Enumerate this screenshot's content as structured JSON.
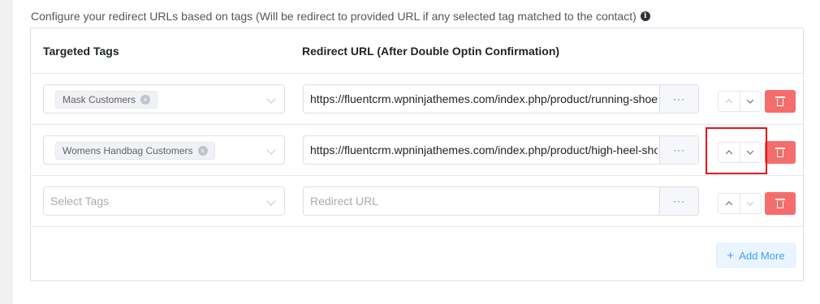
{
  "heading": "Configure your redirect URLs based on tags (Will be redirect to provided URL if any selected tag matched to the contact)",
  "info_icon_glyph": "i",
  "table": {
    "col_tags": "Targeted Tags",
    "col_url": "Redirect URL (After Double Optin Confirmation)"
  },
  "rows": [
    {
      "tag": "Mask Customers",
      "url": "https://fluentcrm.wpninjathemes.com/index.php/product/running-shoe/"
    },
    {
      "tag": "Womens Handbag Customers",
      "url": "https://fluentcrm.wpninjathemes.com/index.php/product/high-heel-shoe/"
    },
    {
      "tag_placeholder": "Select Tags",
      "url_placeholder": "Redirect URL"
    }
  ],
  "url_button_label": "···",
  "tag_remove_glyph": "×",
  "add_more": {
    "plus": "+",
    "label": "Add More"
  },
  "colors": {
    "delete": "#f56c6c",
    "add_more_text": "#409eff",
    "highlight": "#e8151a"
  }
}
